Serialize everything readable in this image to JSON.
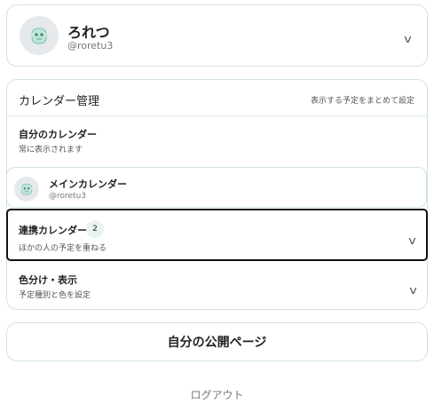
{
  "profile": {
    "name": "ろれつ",
    "handle": "@roretu3",
    "avatar_icon": "ghost-mascot-icon",
    "chevron": "v"
  },
  "calendar_management": {
    "title": "カレンダー管理",
    "merge_link": "表示する予定をまとめて設定",
    "my_calendar": {
      "title": "自分のカレンダー",
      "subtitle": "常に表示されます"
    },
    "main_calendar": {
      "title": "メインカレンダー",
      "handle": "@roretu3"
    },
    "linked_calendar": {
      "title": "連携カレンダー",
      "count": "2",
      "subtitle": "ほかの人の予定を重ねる",
      "chevron": "v"
    },
    "color_display": {
      "title": "色分け・表示",
      "subtitle": "予定種別と色を設定",
      "chevron": "v"
    }
  },
  "public_page_button": "自分の公開ページ",
  "logout_label": "ログアウト",
  "colors": {
    "border": "#cfe3dd",
    "badge_bg": "#e8f4f0",
    "focus_border": "#111111"
  }
}
